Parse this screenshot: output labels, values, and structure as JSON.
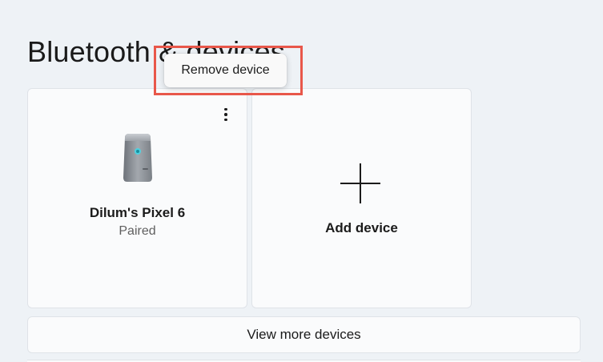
{
  "page": {
    "title": "Bluetooth & devices"
  },
  "device_card": {
    "name": "Dilum's Pixel 6",
    "status": "Paired",
    "icon": "phone-device-icon",
    "more_icon": "more-options-icon"
  },
  "add_card": {
    "label": "Add device",
    "icon": "plus-icon"
  },
  "view_more": {
    "label": "View more devices"
  },
  "context_menu": {
    "items": [
      {
        "label": "Remove device"
      }
    ]
  },
  "colors": {
    "background": "#eef2f6",
    "card": "#fafbfc",
    "highlight": "#e8574a",
    "device_accent": "#4fd1e0"
  }
}
